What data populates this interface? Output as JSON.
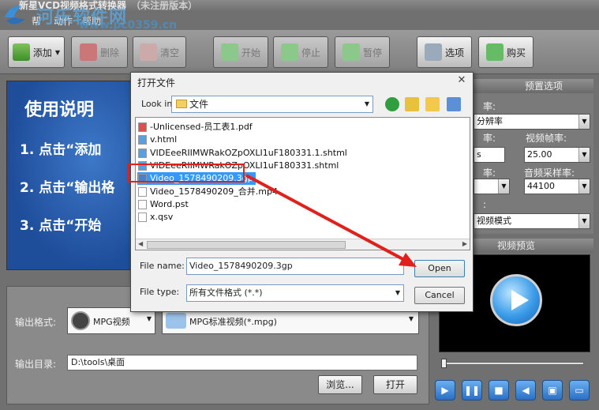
{
  "app": {
    "title": "新星VCD视频格式转换器",
    "title_suffix": "（未注册版本）",
    "menu": [
      "帮",
      "动作",
      "帮助"
    ],
    "watermark": "河乐软件网",
    "watermark_url": "www.pc0359.cn"
  },
  "toolbar": {
    "add": "添加",
    "delete": "删除",
    "clear": "清空",
    "start": "开始",
    "stop": "停止",
    "pause": "暂停",
    "options": "选项",
    "buy": "购买"
  },
  "banner": {
    "title": "使用说明",
    "steps": [
      "1. 点击“添加",
      "2. 点击“输出格",
      "3. 点击“开始"
    ]
  },
  "settings": {
    "header": "预置选项",
    "label_a": "率:",
    "select_a": "分辨率",
    "label_b": "率:",
    "label_fps": "视频帧率:",
    "select_b": "s",
    "fps": "25.00",
    "label_c": "率:",
    "label_samplerate": "音频采样率:",
    "samplerate": "44100",
    "label_d": ":",
    "mode": "视频模式"
  },
  "preview": {
    "header": "视频预览"
  },
  "output": {
    "format_label": "输出格式:",
    "format_value": "MPG视频",
    "format_detail": "MPG标准视频(*.mpg)",
    "dir_label": "输出目录:",
    "dir_value": "D:\\tools\\桌面",
    "browse": "浏览...",
    "open": "打开"
  },
  "dialog": {
    "title": "打开文件",
    "lookin_label": "Look in:",
    "lookin_value": "文件",
    "files": [
      {
        "name": "-Unlicensed-员工表1.pdf",
        "icon": "pdf-icon"
      },
      {
        "name": "v.html",
        "icon": "html-icon"
      },
      {
        "name": "VIDEeeRIIMWRakOZpOXLI1uF180331.1.shtml",
        "icon": "html-icon"
      },
      {
        "name": "VIDEeeRIIMWRakOZpOXLI1uF180331.shtml",
        "icon": "html-icon"
      },
      {
        "name": "Video_1578490209.3gp",
        "icon": "video-file-icon"
      },
      {
        "name": "Video_1578490209_合并.mp4",
        "icon": "file-icon"
      },
      {
        "name": "Word.pst",
        "icon": "file-icon"
      },
      {
        "name": "x.qsv",
        "icon": "file-icon"
      }
    ],
    "selected_index": 4,
    "filename_label": "File name:",
    "filename_value": "Video_1578490209.3gp",
    "filetype_label": "File type:",
    "filetype_value": "所有文件格式 (*.*)",
    "open_button": "Open",
    "cancel_button": "Cancel"
  },
  "colors": {
    "highlight": "#3399ff",
    "annotation_red": "#e0201a"
  }
}
